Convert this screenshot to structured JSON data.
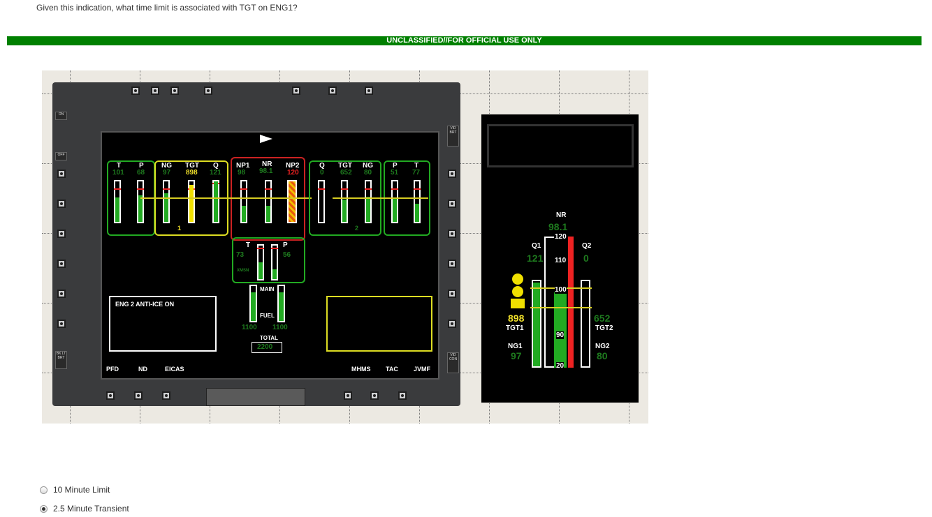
{
  "question": "Given this indication, what time limit is associated with TGT on ENG1?",
  "banner": "UNCLASSIFIED//FOR OFFICIAL USE ONLY",
  "mfd": {
    "switch_on": "ON",
    "switch_off": "OFF",
    "bklt": "BK LT",
    "brt": "BRT",
    "vid_brt": "VID BRT",
    "vid_con": "VID CON",
    "eng1": {
      "t_label": "T",
      "t": "101",
      "p_label": "P",
      "p": "68",
      "ng_label": "NG",
      "ng": "97",
      "tgt_label": "TGT",
      "tgt": "898",
      "q_label": "Q",
      "q": "121",
      "num": "1"
    },
    "rotor": {
      "np1_label": "NP1",
      "np1": "98",
      "nr_label": "NR",
      "nr": "98.1",
      "np2_label": "NP2",
      "np2": "120"
    },
    "eng2": {
      "q_label": "Q",
      "q": "0",
      "tgt_label": "TGT",
      "tgt": "652",
      "ng_label": "NG",
      "ng": "80",
      "p_label": "P",
      "p": "51",
      "t_label": "T",
      "t": "77",
      "num": "2"
    },
    "xmsn": {
      "t_label": "T",
      "t": "73",
      "p_label": "P",
      "p": "56",
      "label": "XMSN"
    },
    "fuel": {
      "main": "MAIN",
      "fuel": "FUEL",
      "left": "1100",
      "right": "1100",
      "total_label": "TOTAL",
      "total": "2200",
      "tank1": "1",
      "tank2": "2"
    },
    "advisory": "ENG 2 ANTI-ICE ON",
    "menu_left": [
      "PFD",
      "ND",
      "EICAS"
    ],
    "menu_right": [
      "MHMS",
      "TAC",
      "JVMF"
    ]
  },
  "panel": {
    "nr_label": "NR",
    "nr": "98.1",
    "q1_label": "Q1",
    "q1": "121",
    "q2_label": "Q2",
    "q2": "0",
    "scale": [
      "120",
      "110",
      "100",
      "90",
      "20"
    ],
    "tgt1": "898",
    "tgt1_label": "TGT1",
    "tgt2": "652",
    "tgt2_label": "TGT2",
    "ng1_label": "NG1",
    "ng1": "97",
    "ng2_label": "NG2",
    "ng2": "80"
  },
  "options": [
    {
      "label": "10 Minute Limit",
      "selected": false
    },
    {
      "label": "2.5 Minute Transient",
      "selected": true
    }
  ]
}
